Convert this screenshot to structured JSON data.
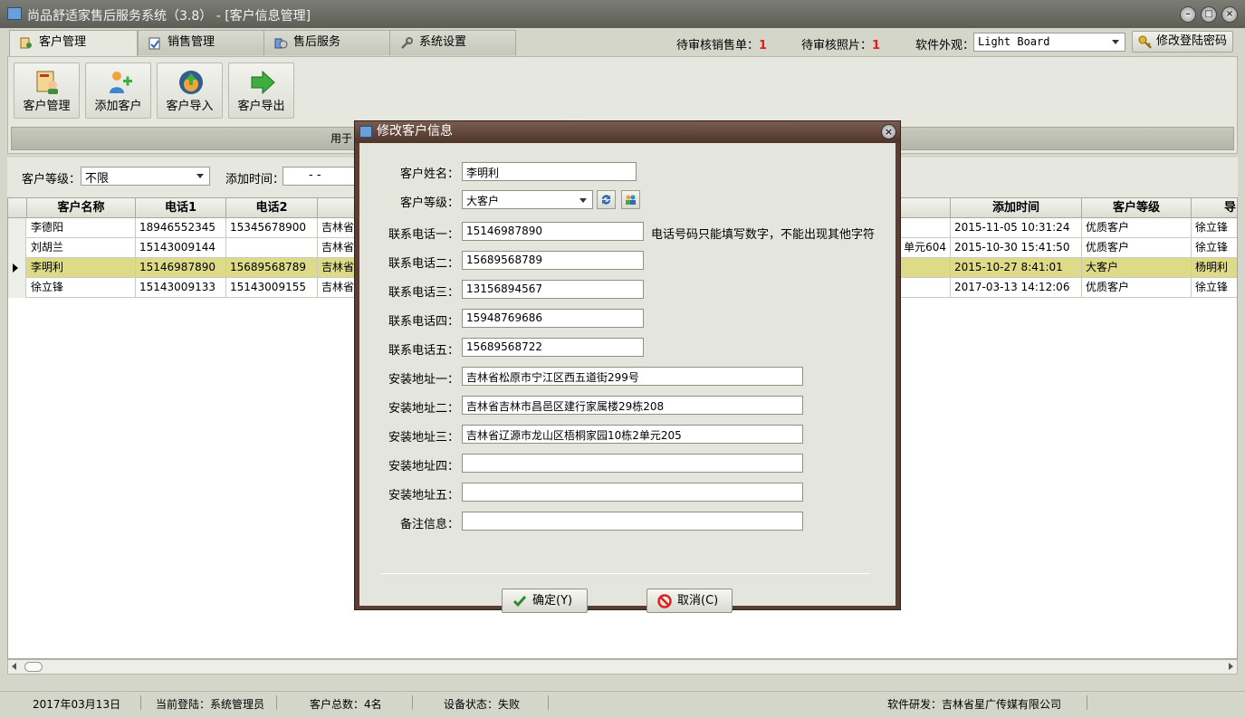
{
  "window": {
    "title": "尚品舒适家售后服务系统（3.8） - [客户信息管理]"
  },
  "tabs": [
    {
      "label": "客户管理",
      "icon": "customer-manage-icon"
    },
    {
      "label": "销售管理",
      "icon": "sales-icon"
    },
    {
      "label": "售后服务",
      "icon": "service-icon"
    },
    {
      "label": "系统设置",
      "icon": "settings-icon"
    }
  ],
  "header": {
    "pending_sales_label": "待审核销售单：",
    "pending_sales_count": "1",
    "pending_photos_label": "待审核照片：",
    "pending_photos_count": "1",
    "skin_label": "软件外观：",
    "skin_value": "Light Board",
    "change_password": "修改登陆密码"
  },
  "toolbar": {
    "buttons": [
      "客户管理",
      "添加客户",
      "客户导入",
      "客户导出"
    ],
    "description": "用于"
  },
  "filter": {
    "level_label": "客户等级：",
    "level_value": "不限",
    "time_label": "添加时间：",
    "time_value": "-   -"
  },
  "table": {
    "columns": [
      "客户名称",
      "电话1",
      "电话2",
      "添加时间",
      "客户等级",
      "导"
    ],
    "rows": [
      {
        "name": "李德阳",
        "phone1": "18946552345",
        "phone2": "15345678900",
        "addr": "吉林省",
        "addr_tail": "",
        "time": "2015-11-05 10:31:24",
        "level": "优质客户",
        "owner": "徐立锋"
      },
      {
        "name": "刘胡兰",
        "phone1": "15143009144",
        "phone2": "",
        "addr": "吉林省",
        "addr_tail": "单元604",
        "time": "2015-10-30 15:41:50",
        "level": "优质客户",
        "owner": "徐立锋"
      },
      {
        "name": "李明利",
        "phone1": "15146987890",
        "phone2": "15689568789",
        "addr": "吉林省",
        "addr_tail": "",
        "time": "2015-10-27  8:41:01",
        "level": "大客户",
        "owner": "杨明利"
      },
      {
        "name": "徐立锋",
        "phone1": "15143009133",
        "phone2": "15143009155",
        "addr": "吉林省",
        "addr_tail": "",
        "time": "2017-03-13 14:12:06",
        "level": "优质客户",
        "owner": "徐立锋"
      }
    ]
  },
  "status": {
    "date": "2017年03月13日",
    "login": "当前登陆：系统管理员",
    "total": "客户总数：4名",
    "device": "设备状态：失败",
    "developer": "软件研发：吉林省星广传媒有限公司"
  },
  "dialog": {
    "title": "修改客户信息",
    "name_label": "客户姓名：",
    "name_value": "李明利",
    "level_label": "客户等级：",
    "level_value": "大客户",
    "phone1_label": "联系电话一：",
    "phone1_value": "15146987890",
    "phone_hint": "电话号码只能填写数字，不能出现其他字符",
    "phone2_label": "联系电话二：",
    "phone2_value": "15689568789",
    "phone3_label": "联系电话三：",
    "phone3_value": "13156894567",
    "phone4_label": "联系电话四：",
    "phone4_value": "15948769686",
    "phone5_label": "联系电话五：",
    "phone5_value": "15689568722",
    "addr1_label": "安装地址一：",
    "addr1_value": "吉林省松原市宁江区西五道街299号",
    "addr2_label": "安装地址二：",
    "addr2_value": "吉林省吉林市昌邑区建行家属楼29栋208",
    "addr3_label": "安装地址三：",
    "addr3_value": "吉林省辽源市龙山区梧桐家园10栋2单元205",
    "addr4_label": "安装地址四：",
    "addr4_value": "",
    "addr5_label": "安装地址五：",
    "addr5_value": "",
    "note_label": "备注信息：",
    "note_value": "",
    "ok_label": "确定(Y)",
    "cancel_label": "取消(C)"
  }
}
